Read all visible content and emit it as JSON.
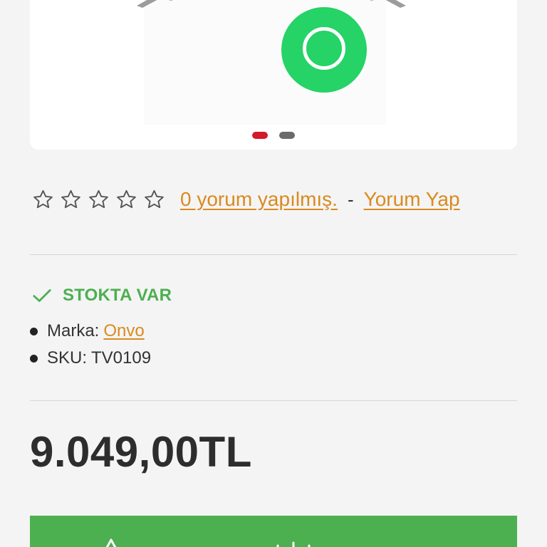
{
  "carousel": {
    "slide_count": 2,
    "active_index": 0,
    "colors": {
      "active_dot": "#d3192a",
      "inactive_dot": "#6b6b6b"
    }
  },
  "rating": {
    "stars_total": 5,
    "stars_filled": 0,
    "reviews_link": "0 yorum yapılmış.",
    "separator": "-",
    "write_review_link": "Yorum Yap"
  },
  "stock": {
    "status": "STOKTA VAR",
    "icon": "check-icon",
    "color": "#4caf50"
  },
  "meta": {
    "brand_label": "Marka:",
    "brand_value": "Onvo",
    "sku_label": "SKU:",
    "sku_value": "TV0109"
  },
  "price": "9.049,00TL",
  "colors": {
    "link": "#d98a1f",
    "action_bar": "#4caf50",
    "whatsapp": "#25d366"
  }
}
